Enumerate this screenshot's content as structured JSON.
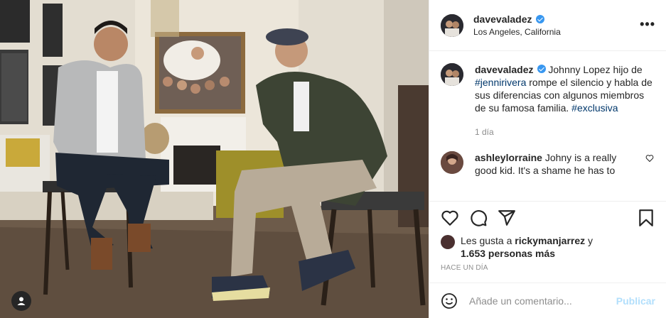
{
  "post": {
    "username": "davevaladez",
    "location": "Los Angeles, California",
    "more_label": "•••"
  },
  "caption": {
    "username": "davevaladez",
    "text_1": " Johnny Lopez hijo de ",
    "hashtag_1": "#jennirivera",
    "text_2": " rompe el silencio y habla de sus diferencias con algunos miembros de su famosa familia. ",
    "hashtag_2": "#exclusiva",
    "time": "1 día"
  },
  "comments": [
    {
      "username": "ashleylorraine",
      "text": " Johny is a really good kid. It's a shame he has to"
    }
  ],
  "likes": {
    "prefix": "Les gusta a ",
    "user": "rickymanjarrez",
    "suffix": " y",
    "count": "1.653 personas más"
  },
  "posted_ago": "HACE UN DÍA",
  "add_comment": {
    "placeholder": "Añade un comentario...",
    "publish_label": "Publicar"
  },
  "icons": [
    "verified-badge-icon",
    "more-options-icon",
    "heart-icon",
    "comment-icon",
    "share-icon",
    "bookmark-icon",
    "emoji-icon",
    "tag-people-icon"
  ],
  "colors": {
    "link": "#00376b",
    "verified": "#3897f0",
    "muted": "#8e8e8e",
    "publish": "#b2dffc"
  }
}
